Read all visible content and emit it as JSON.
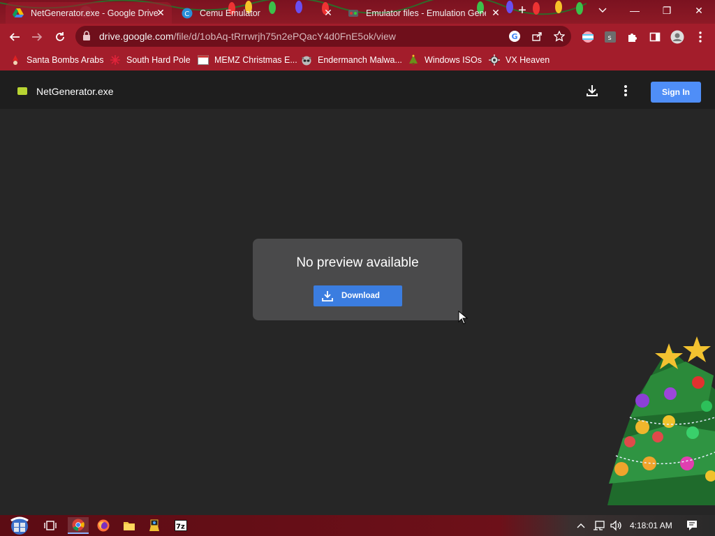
{
  "browser": {
    "tabs": [
      {
        "title": "NetGenerator.exe - Google Drive",
        "active": true
      },
      {
        "title": "Cemu Emulator",
        "active": false
      },
      {
        "title": "Emulator files - Emulation General",
        "active": false
      }
    ],
    "new_tab_label": "+",
    "close_glyph": "✕",
    "window_controls": {
      "minimize": "—",
      "restore": "❐",
      "close": "✕"
    },
    "url": {
      "host": "drive.google.com",
      "path": "/file/d/1obAq-tRrrwrjh75n2ePQacY4d0FnE5ok/view"
    },
    "bookmarks": [
      {
        "label": "Santa Bombs Arabs",
        "icon": "santa-icon"
      },
      {
        "label": "South Hard Pole",
        "icon": "snowflake-icon"
      },
      {
        "label": "MEMZ Christmas E...",
        "icon": "window-icon"
      },
      {
        "label": "Endermanch Malwa...",
        "icon": "raccoon-icon"
      },
      {
        "label": "Windows ISOs",
        "icon": "tree-icon"
      },
      {
        "label": "VX Heaven",
        "icon": "virus-icon"
      }
    ]
  },
  "drive": {
    "file_name": "NetGenerator.exe",
    "sign_in_label": "Sign In",
    "no_preview_text": "No preview available",
    "download_label": "Download"
  },
  "taskbar": {
    "clock": "4:18:01 AM"
  },
  "colors": {
    "accent_blue": "#3b7de0",
    "signin_blue": "#4f8ef7",
    "chrome_red": "#a31d2b"
  }
}
